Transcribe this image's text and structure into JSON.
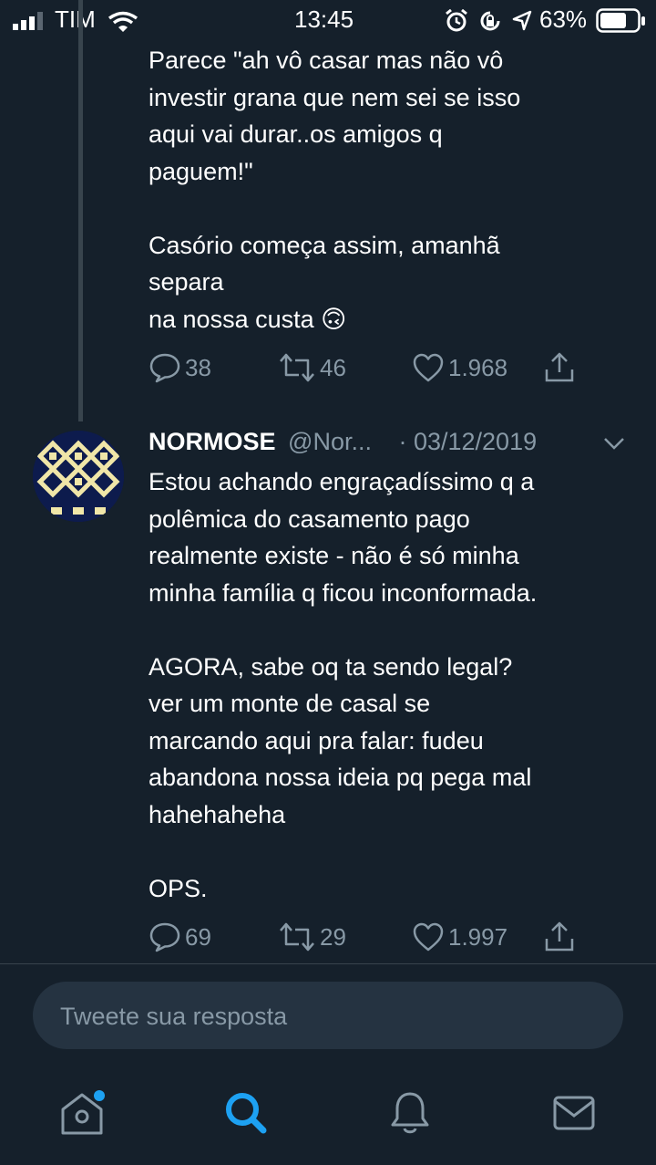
{
  "status_bar": {
    "carrier": "TIM",
    "time": "13:45",
    "battery": "63%",
    "icons": [
      "signal-icon",
      "wifi-icon",
      "alarm-icon",
      "rotation-lock-icon",
      "location-icon",
      "battery-icon"
    ]
  },
  "tweets": [
    {
      "text": "Parece \"ah vô casar mas não vô\ninvestir grana que nem sei se isso\naqui vai durar..os amigos q\npaguem!\"\n\nCasório começa assim, amanhã\nsepara\nna nossa custa 🙃",
      "replies": "38",
      "retweets": "46",
      "likes": "1.968"
    },
    {
      "author_name": "NORMOSE",
      "handle": "@Nor...",
      "date": "· 03/12/2019",
      "text": "Estou achando engraçadíssimo q a\npolêmica do casamento pago\nrealmente existe - não é só minha\nminha família q ficou inconformada.\n\nAGORA, sabe oq ta sendo legal?\nver um monte de casal se\nmarcando aqui pra falar: fudeu\nabandona nossa ideia pq pega mal\nhahehaheha\n\nOPS.",
      "replies": "69",
      "retweets": "29",
      "likes": "1.997"
    }
  ],
  "reply": {
    "placeholder": "Tweete sua resposta"
  },
  "tab_bar": [
    "home-icon",
    "search-icon",
    "notifications-icon",
    "messages-icon"
  ],
  "colors": {
    "background": "#15202b",
    "accent": "#1da1f2",
    "muted": "#8899a6",
    "divider": "#38444d"
  }
}
